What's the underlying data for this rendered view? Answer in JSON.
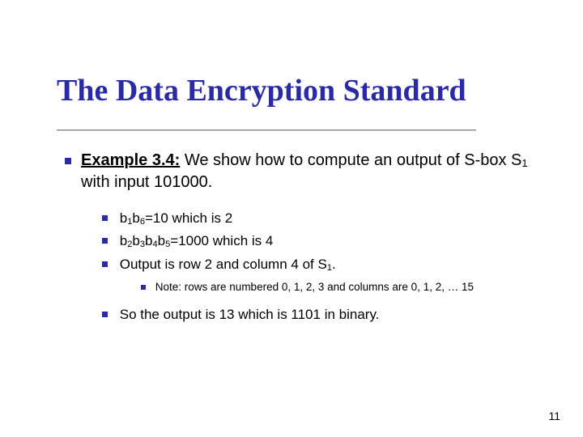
{
  "title": "The Data Encryption Standard",
  "lead": {
    "label": "Example 3.4:",
    "text_before_sub": " We show how to compute an output of S-box S",
    "sub": "1",
    "text_after_sub": " with input 101000."
  },
  "sub_bullets": {
    "b1": {
      "pre": "b",
      "s1": "1",
      "mid": "b",
      "s2": "6",
      "rest": "=10 which is 2"
    },
    "b2": {
      "pre": "b",
      "s1": "2",
      "m1": "b",
      "s2": "3",
      "m2": "b",
      "s3": "4",
      "m3": "b",
      "s4": "5",
      "rest": "=1000 which is 4"
    },
    "b3": {
      "pre": "Output is row 2 and column 4 of S",
      "s1": "1",
      "post": "."
    }
  },
  "note": "Note: rows are numbered 0, 1, 2, 3 and columns are 0, 1, 2, … 15",
  "conclusion": "So the output is 13 which is 1101 in binary.",
  "page_number": "11"
}
